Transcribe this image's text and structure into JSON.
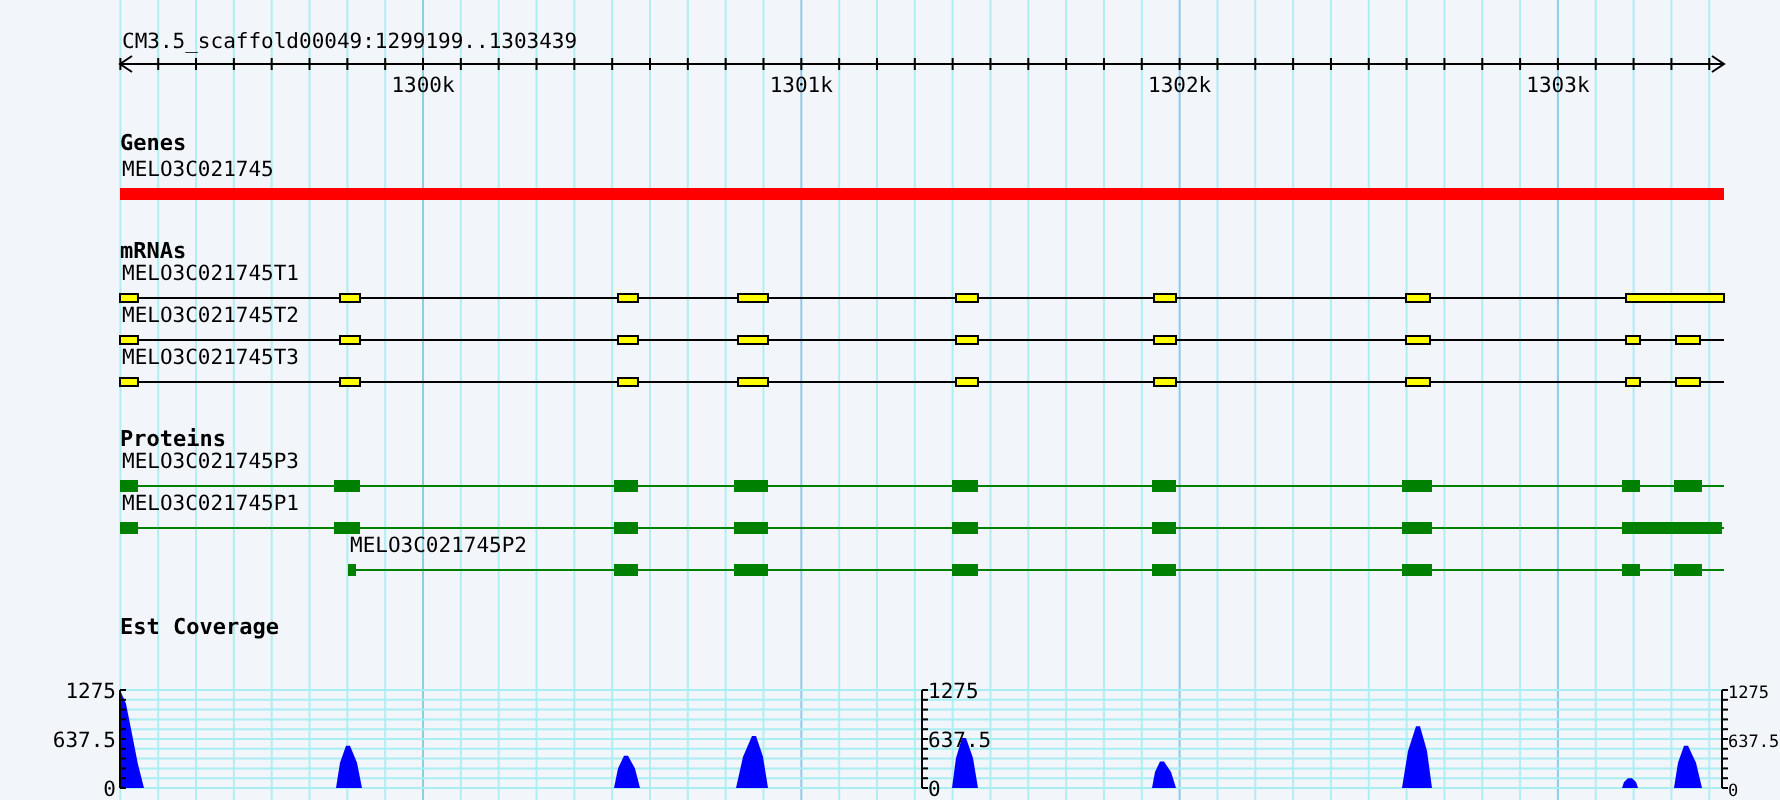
{
  "ruler": {
    "title": "CM3.5_scaffold00049:1299199..1303439",
    "ticks": [
      {
        "label": "1300k"
      },
      {
        "label": "1301k"
      },
      {
        "label": "1302k"
      },
      {
        "label": "1303k"
      }
    ]
  },
  "tracks": [
    {
      "kind": "gene",
      "title": "Genes",
      "features": [
        {
          "name": "MELO3C021745"
        }
      ]
    },
    {
      "kind": "mrna",
      "title": "mRNAs",
      "features": [
        {
          "name": "MELO3C021745T1"
        },
        {
          "name": "MELO3C021745T2"
        },
        {
          "name": "MELO3C021745T3"
        }
      ]
    },
    {
      "kind": "protein",
      "title": "Proteins",
      "features": [
        {
          "name": "MELO3C021745P3"
        },
        {
          "name": "MELO3C021745P1"
        },
        {
          "name": "MELO3C021745P2"
        }
      ]
    },
    {
      "kind": "coverage",
      "title": "Est Coverage",
      "axes": [
        {
          "ticks": [
            {
              "label": "1275"
            },
            {
              "label": "637.5"
            },
            {
              "label": "0"
            }
          ]
        },
        {
          "ticks": [
            {
              "label": "1275"
            },
            {
              "label": "637.5"
            },
            {
              "label": "0"
            }
          ]
        },
        {
          "ticks": [
            {
              "label": "1275"
            },
            {
              "label": "637.5"
            },
            {
              "label": "0"
            }
          ]
        }
      ]
    }
  ]
}
